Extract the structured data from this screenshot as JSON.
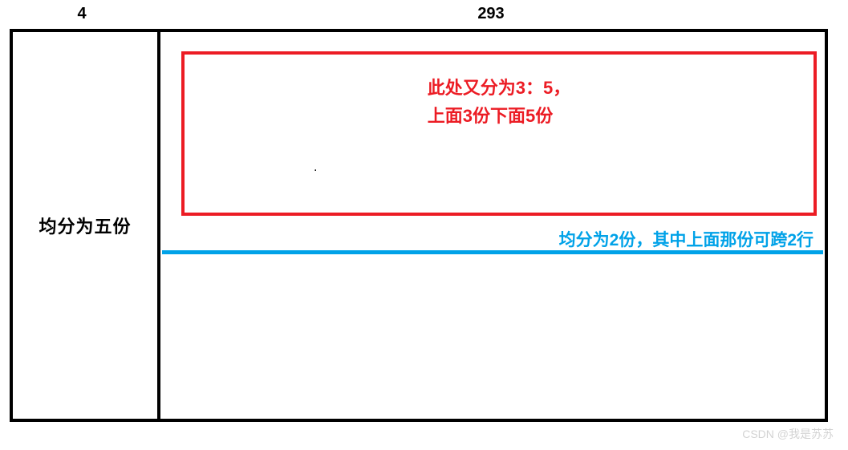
{
  "header": {
    "left_label": "4",
    "right_label": "293"
  },
  "left_panel": {
    "label": "均分为五份"
  },
  "red_box": {
    "line1": "此处又分为3：5，",
    "line2": "上面3份下面5份"
  },
  "blue_annotation": {
    "label": "均分为2份，其中上面那份可跨2行"
  },
  "mark": {
    "dot": "."
  },
  "watermark": {
    "text": "CSDN @我是苏苏"
  }
}
